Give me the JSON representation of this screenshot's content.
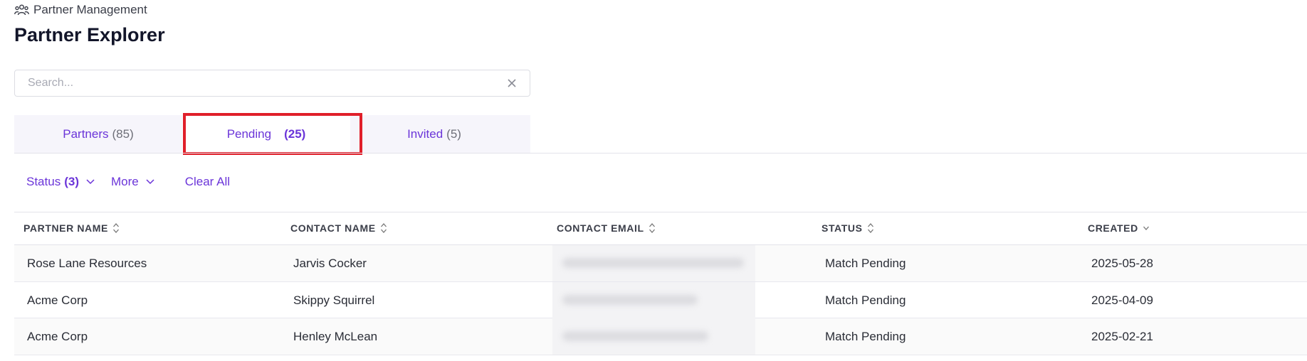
{
  "breadcrumb": {
    "icon": "users-icon",
    "label": "Partner Management"
  },
  "page_title": "Partner Explorer",
  "search": {
    "placeholder": "Search...",
    "value": ""
  },
  "tabs": [
    {
      "label": "Partners",
      "count": "(85)"
    },
    {
      "label": "Pending",
      "count": "(25)"
    },
    {
      "label": "Invited",
      "count": "(5)"
    }
  ],
  "filters": {
    "status_label": "Status",
    "status_count": "(3)",
    "more_label": "More",
    "clear_all_label": "Clear All"
  },
  "table": {
    "headers": [
      "PARTNER NAME",
      "CONTACT NAME",
      "CONTACT EMAIL",
      "STATUS",
      "CREATED"
    ],
    "rows": [
      {
        "partner": "Rose Lane Resources",
        "contact": "Jarvis Cocker",
        "status": "Match Pending",
        "created": "2025-05-28"
      },
      {
        "partner": "Acme Corp",
        "contact": "Skippy Squirrel",
        "status": "Match Pending",
        "created": "2025-04-09"
      },
      {
        "partner": "Acme Corp",
        "contact": "Henley McLean",
        "status": "Match Pending",
        "created": "2025-02-21"
      }
    ]
  },
  "colors": {
    "accent": "#6b35d9",
    "highlight": "#e01f2a"
  }
}
